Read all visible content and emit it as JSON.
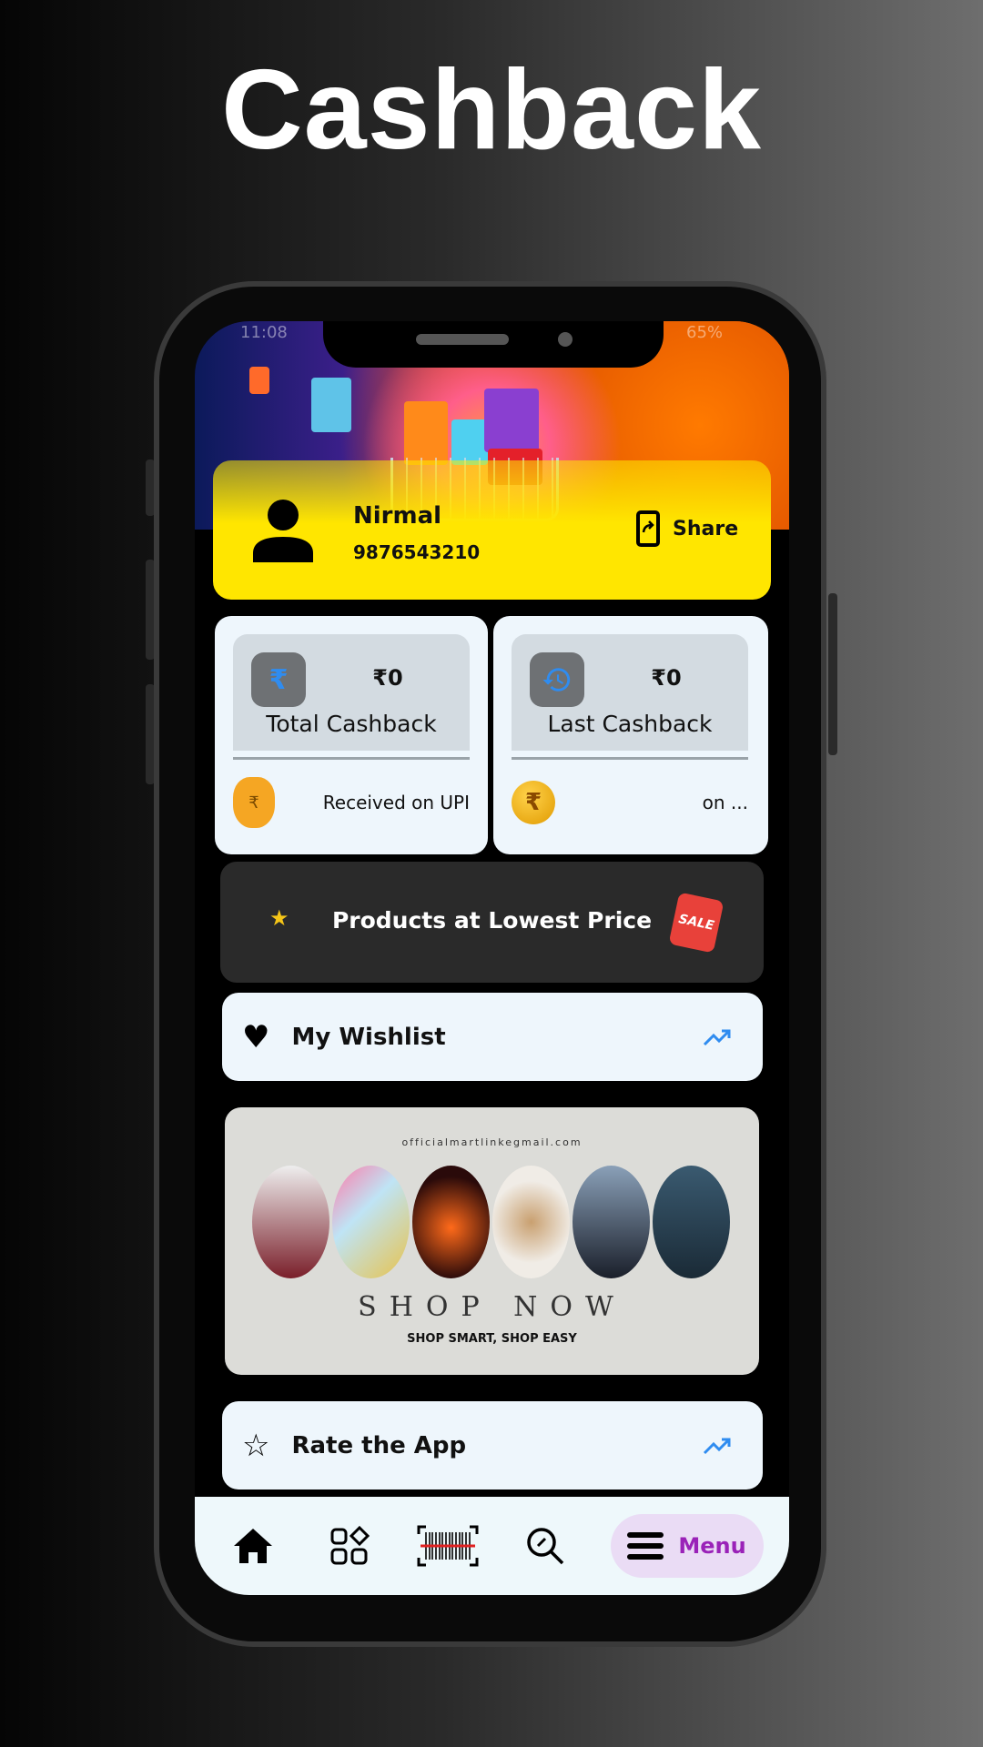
{
  "page_title": "Cashback",
  "status_bar": {
    "time": "11:08",
    "battery": "65%"
  },
  "profile": {
    "name": "Nirmal",
    "phone": "9876543210",
    "share_label": "Share"
  },
  "cards": [
    {
      "icon": "rupee-icon",
      "amount": "₹0",
      "label": "Total Cashback",
      "footer": "Received on UPI",
      "footer_icon": "money-bag-icon"
    },
    {
      "icon": "history-icon",
      "amount": "₹0",
      "label": "Last Cashback",
      "footer": "on ...",
      "footer_icon": "rupee-coin-icon"
    }
  ],
  "deals": {
    "label": "Products at Lowest Price",
    "badge": "SALE"
  },
  "wishlist": {
    "label": "My Wishlist"
  },
  "shop_banner": {
    "email": "officialmartlinkegmail.com",
    "headline": "SHOP NOW",
    "tagline": "SHOP SMART, SHOP EASY"
  },
  "rate": {
    "label": "Rate the App"
  },
  "nav": {
    "items": [
      "home",
      "categories",
      "barcode-scanner",
      "link-search"
    ],
    "menu_label": "Menu"
  },
  "colors": {
    "profile_bg": "#ffe600",
    "accent_blue": "#2f8cf0",
    "menu_purple": "#9a22b8",
    "menu_bg": "#eadcf5"
  }
}
